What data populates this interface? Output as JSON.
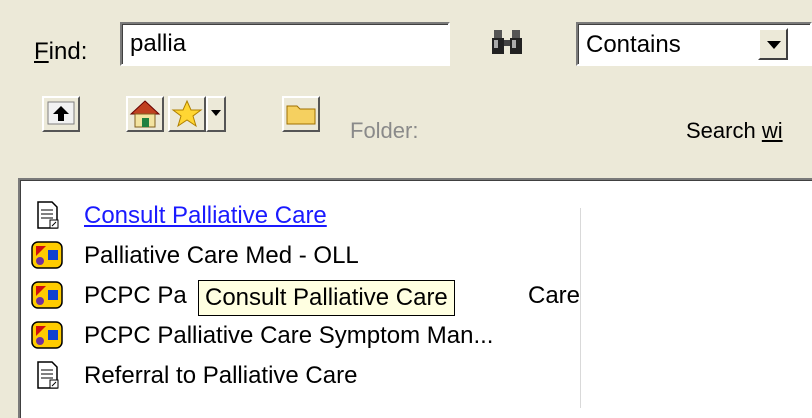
{
  "find": {
    "label": "Find:",
    "value": "pallia",
    "placeholder": ""
  },
  "search_mode": {
    "selected": "Contains"
  },
  "toolbar": {
    "folder_label": "Folder:",
    "search_within_prefix": "Search ",
    "search_within_underlined": "wi"
  },
  "list": {
    "items": [
      {
        "label": "Consult Palliative Care",
        "icon": "document-icon",
        "link": true
      },
      {
        "label": "Palliative Care Med - OLL",
        "icon": "order-set-icon",
        "link": false
      },
      {
        "label": "PCPC Pa",
        "label_tail": "Care",
        "icon": "order-set-icon",
        "link": false
      },
      {
        "label": "PCPC Palliative Care Symptom Man...",
        "icon": "order-set-icon",
        "link": false
      },
      {
        "label": "Referral to Palliative Care",
        "icon": "document-icon",
        "link": false
      }
    ]
  },
  "tooltip": {
    "text": "Consult Palliative Care"
  },
  "colors": {
    "background": "#ece9d8",
    "link": "#1a1aff",
    "tooltip_bg": "#ffffe1"
  }
}
